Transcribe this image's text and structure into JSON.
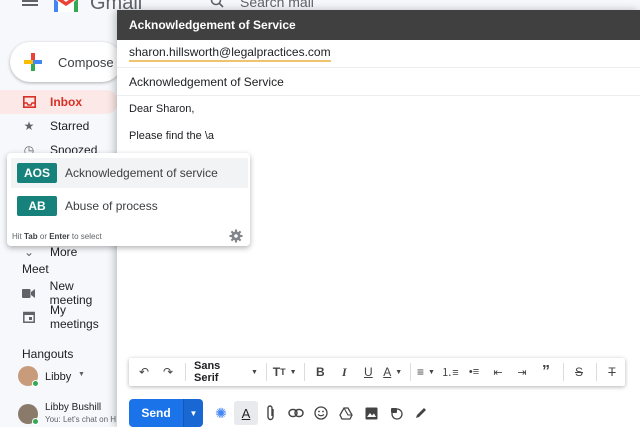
{
  "app": {
    "logo_text": "Gmail",
    "search_placeholder": "Search mail"
  },
  "sidebar": {
    "compose_label": "Compose",
    "items": [
      {
        "label": "Inbox",
        "icon": "inbox-icon",
        "active": true
      },
      {
        "label": "Starred",
        "icon": "star-icon",
        "active": false
      },
      {
        "label": "Snoozed",
        "icon": "clock-icon",
        "active": false
      },
      {
        "label": "More",
        "icon": "chevron-down-icon",
        "active": false
      }
    ],
    "meet": {
      "title": "Meet",
      "items": [
        {
          "label": "New meeting",
          "icon": "video-icon"
        },
        {
          "label": "My meetings",
          "icon": "calendar-icon"
        }
      ]
    },
    "hangouts": {
      "title": "Hangouts",
      "user": "Libby",
      "contact_name": "Libby Bushill",
      "contact_preview": "You: Let's chat on H"
    }
  },
  "compose": {
    "header_title": "Acknowledgement of Service",
    "to": "sharon.hillsworth@legalpractices.com",
    "subject": "Acknowledgement of Service",
    "body_lines": [
      "Dear Sharon,",
      "Please find the \\a"
    ]
  },
  "autocomplete": {
    "items": [
      {
        "abbr": "AOS",
        "label": "Acknowledgement of service",
        "selected": true
      },
      {
        "abbr": "AB",
        "label": "Abuse of process",
        "selected": false
      }
    ],
    "hint": {
      "pre": "Hit ",
      "key1": "Tab",
      "mid": " or ",
      "key2": "Enter",
      "post": " to select"
    },
    "accent_color": "#16827b"
  },
  "toolbar": {
    "font": "Sans Serif",
    "buttons": [
      "undo-icon",
      "redo-icon",
      "font-select",
      "text-size-icon",
      "bold-icon",
      "italic-icon",
      "underline-icon",
      "text-color-icon",
      "align-icon",
      "numbered-list-icon",
      "bulleted-list-icon",
      "indent-less-icon",
      "indent-more-icon",
      "quote-icon",
      "strikethrough-icon",
      "clear-formatting-icon"
    ]
  },
  "bottom": {
    "send_label": "Send",
    "send_color": "#1a73e8"
  }
}
